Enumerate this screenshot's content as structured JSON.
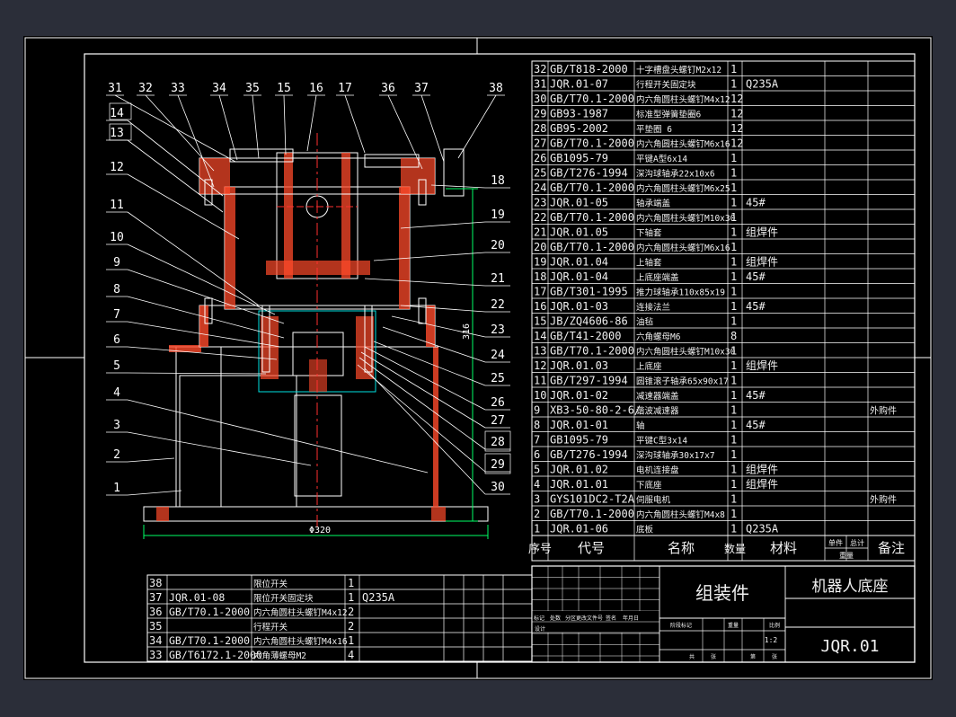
{
  "balloons_left": [
    "31",
    "32",
    "33",
    "34",
    "35",
    "15",
    "16",
    "17",
    "36",
    "37",
    "38",
    "14",
    "13",
    "12",
    "11",
    "10",
    "9",
    "8",
    "7",
    "6",
    "5",
    "4",
    "3",
    "2",
    "1"
  ],
  "balloons_right": [
    "18",
    "19",
    "20",
    "21",
    "22",
    "23",
    "24",
    "25",
    "26",
    "27",
    "28",
    "29",
    "30"
  ],
  "dimensions": {
    "width": "Φ320",
    "height": "316"
  },
  "bom_rows": [
    {
      "no": "32",
      "code": "GB/T818-2000",
      "name": "十字槽盘头螺钉M2x12",
      "qty": "1",
      "mat": "",
      "note": ""
    },
    {
      "no": "31",
      "code": "JQR.01-07",
      "name": "行程开关固定块",
      "qty": "1",
      "mat": "Q235A",
      "note": ""
    },
    {
      "no": "30",
      "code": "GB/T70.1-2000",
      "name": "内六角圆柱头螺钉M4x12",
      "qty": "12",
      "mat": "",
      "note": ""
    },
    {
      "no": "29",
      "code": "GB93-1987",
      "name": "标准型弹簧垫圈6",
      "qty": "12",
      "mat": "",
      "note": ""
    },
    {
      "no": "28",
      "code": "GB95-2002",
      "name": "平垫圈 6",
      "qty": "12",
      "mat": "",
      "note": ""
    },
    {
      "no": "27",
      "code": "GB/T70.1-2000",
      "name": "内六角圆柱头螺钉M6x16",
      "qty": "12",
      "mat": "",
      "note": ""
    },
    {
      "no": "26",
      "code": "GB1095-79",
      "name": "平键A型6x14",
      "qty": "1",
      "mat": "",
      "note": ""
    },
    {
      "no": "25",
      "code": "GB/T276-1994",
      "name": "深沟球轴承22x10x6",
      "qty": "1",
      "mat": "",
      "note": ""
    },
    {
      "no": "24",
      "code": "GB/T70.1-2000",
      "name": "内六角圆柱头螺钉M6x25",
      "qty": "1",
      "mat": "",
      "note": ""
    },
    {
      "no": "23",
      "code": "JQR.01-05",
      "name": "轴承端盖",
      "qty": "1",
      "mat": "45#",
      "note": ""
    },
    {
      "no": "22",
      "code": "GB/T70.1-2000",
      "name": "内六角圆柱头螺钉M10x30",
      "qty": "1",
      "mat": "",
      "note": ""
    },
    {
      "no": "21",
      "code": "JQR.01.05",
      "name": "下轴套",
      "qty": "1",
      "mat": "组焊件",
      "note": ""
    },
    {
      "no": "20",
      "code": "GB/T70.1-2000",
      "name": "内六角圆柱头螺钉M6x16",
      "qty": "1",
      "mat": "",
      "note": ""
    },
    {
      "no": "19",
      "code": "JQR.01.04",
      "name": "上轴套",
      "qty": "1",
      "mat": "组焊件",
      "note": ""
    },
    {
      "no": "18",
      "code": "JQR.01-04",
      "name": "上底座端盖",
      "qty": "1",
      "mat": "45#",
      "note": ""
    },
    {
      "no": "17",
      "code": "GB/T301-1995",
      "name": "推力球轴承110x85x19",
      "qty": "1",
      "mat": "",
      "note": ""
    },
    {
      "no": "16",
      "code": "JQR.01-03",
      "name": "连接法兰",
      "qty": "1",
      "mat": "45#",
      "note": ""
    },
    {
      "no": "15",
      "code": "JB/ZQ4606-86",
      "name": "油毡",
      "qty": "1",
      "mat": "",
      "note": ""
    },
    {
      "no": "14",
      "code": "GB/T41-2000",
      "name": "六角螺母M6",
      "qty": "8",
      "mat": "",
      "note": ""
    },
    {
      "no": "13",
      "code": "GB/T70.1-2000",
      "name": "内六角圆柱头螺钉M10x30",
      "qty": "1",
      "mat": "",
      "note": ""
    },
    {
      "no": "12",
      "code": "JQR.01.03",
      "name": "上底座",
      "qty": "1",
      "mat": "组焊件",
      "note": ""
    },
    {
      "no": "11",
      "code": "GB/T297-1994",
      "name": "圆锥滚子轴承65x90x17",
      "qty": "1",
      "mat": "",
      "note": ""
    },
    {
      "no": "10",
      "code": "JQR.01-02",
      "name": "减速器端盖",
      "qty": "1",
      "mat": "45#",
      "note": ""
    },
    {
      "no": "9",
      "code": "XB3-50-80-2-6/",
      "name": "谐波减速器",
      "qty": "1",
      "mat": "",
      "note": "外购件"
    },
    {
      "no": "8",
      "code": "JQR.01-01",
      "name": "轴",
      "qty": "1",
      "mat": "45#",
      "note": ""
    },
    {
      "no": "7",
      "code": "GB1095-79",
      "name": "平键C型3x14",
      "qty": "1",
      "mat": "",
      "note": ""
    },
    {
      "no": "6",
      "code": "GB/T276-1994",
      "name": "深沟球轴承30x17x7",
      "qty": "1",
      "mat": "",
      "note": ""
    },
    {
      "no": "5",
      "code": "JQR.01.02",
      "name": "电机连接盘",
      "qty": "1",
      "mat": "组焊件",
      "note": ""
    },
    {
      "no": "4",
      "code": "JQR.01.01",
      "name": "下底座",
      "qty": "1",
      "mat": "组焊件",
      "note": ""
    },
    {
      "no": "3",
      "code": "GYS101DC2-T2A",
      "name": "伺服电机",
      "qty": "1",
      "mat": "",
      "note": "外购件"
    },
    {
      "no": "2",
      "code": "GB/T70.1-2000",
      "name": "内六角圆柱头螺钉M4x8",
      "qty": "1",
      "mat": "",
      "note": ""
    },
    {
      "no": "1",
      "code": "JQR.01-06",
      "name": "底板",
      "qty": "1",
      "mat": "Q235A",
      "note": ""
    }
  ],
  "bom_header": {
    "no": "序号",
    "code": "代号",
    "name": "名称",
    "qty": "数量",
    "mat": "材料",
    "unit_weight": "单件",
    "total_weight": "总计",
    "weight": "重量",
    "note": "备注"
  },
  "left_rows": [
    {
      "no": "38",
      "code": "",
      "name": "限位开关",
      "qty": "1",
      "mat": ""
    },
    {
      "no": "37",
      "code": "JQR.01-08",
      "name": "限位开关固定块",
      "qty": "1",
      "mat": "Q235A"
    },
    {
      "no": "36",
      "code": "GB/T70.1-2000",
      "name": "内六角圆柱头螺钉M4x12",
      "qty": "2",
      "mat": ""
    },
    {
      "no": "35",
      "code": "",
      "name": "行程开关",
      "qty": "2",
      "mat": ""
    },
    {
      "no": "34",
      "code": "GB/T70.1-2000",
      "name": "内六角圆柱头螺钉M4x16",
      "qty": "1",
      "mat": ""
    },
    {
      "no": "33",
      "code": "GB/T6172.1-2000",
      "name": "六角薄螺母M2",
      "qty": "4",
      "mat": ""
    }
  ],
  "title_block": {
    "assembly": "组装件",
    "drawing_name": "机器人底座",
    "drawing_code": "JQR.01",
    "scale": "1:2",
    "marks": [
      "标记",
      "处数",
      "分区",
      "更改文件号",
      "签名",
      "年月日"
    ],
    "roles": [
      "设计",
      "标准化",
      "审核",
      "工艺",
      "批准"
    ],
    "stage_labels": [
      "阶段标记",
      "重量",
      "比例"
    ],
    "sheet_labels": [
      "共",
      "张",
      "第",
      "张"
    ]
  },
  "colors": {
    "line": "#ffffff",
    "hatch": "#ff4a2a",
    "center": "#ff3030",
    "body": "#00e0e0",
    "text": "#f0f0f0",
    "dim": "#00ff66",
    "leader": "#ffffff",
    "balloon_text": "#ffffff"
  }
}
